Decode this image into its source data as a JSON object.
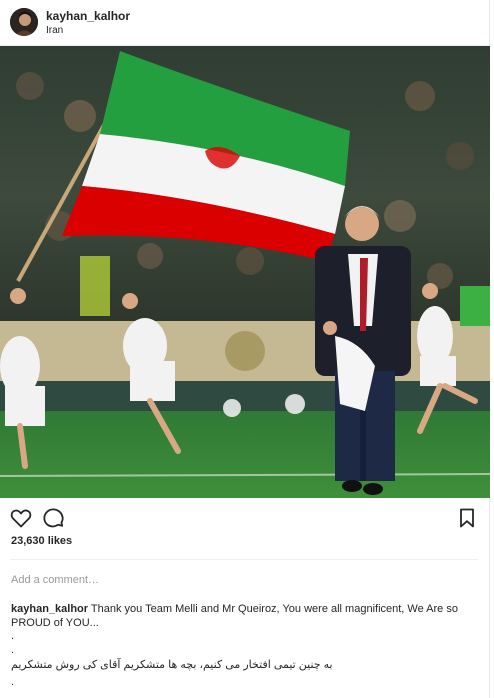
{
  "header": {
    "username": "kayhan_kalhor",
    "location": "Iran"
  },
  "post": {
    "image_description_icon": "photo-icon"
  },
  "actions": {
    "like_icon": "heart-icon",
    "comment_icon": "comment-icon",
    "save_icon": "bookmark-icon"
  },
  "likes": "23,630 likes",
  "comment_box": {
    "placeholder": "Add a comment…"
  },
  "caption": {
    "author": "kayhan_kalhor",
    "text": "Thank you Team Melli and Mr Queiroz, You were all magnificent, We Are so PROUD of YOU...",
    "dot_1": ".",
    "dot_2": ".",
    "farsi": "به چنین تیمی افتخار می کنیم، بچه ها متشکریم آقای کی روش متشکریم",
    "dot_3": "."
  },
  "colors": {
    "text": "#262626",
    "muted": "#999999",
    "flag_green": "#239f40",
    "flag_red": "#da0000"
  }
}
